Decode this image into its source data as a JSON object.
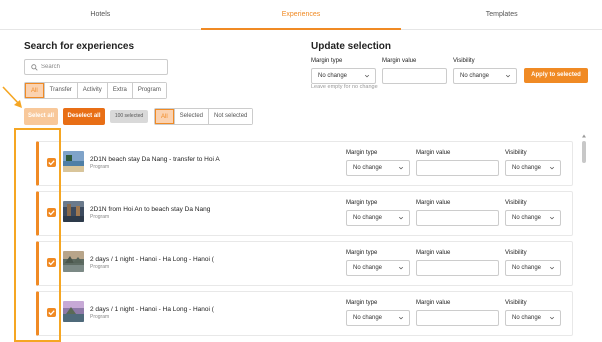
{
  "tabs": [
    "Hotels",
    "Experiences",
    "Templates"
  ],
  "search_panel": {
    "title": "Search for experiences",
    "search_placeholder": "Search",
    "type_filters": [
      "All",
      "Transfer",
      "Activity",
      "Extra",
      "Program"
    ]
  },
  "update_panel": {
    "title": "Update selection",
    "margin_type_label": "Margin type",
    "margin_value_label": "Margin value",
    "visibility_label": "Visibility",
    "margin_type_value": "No change",
    "visibility_value": "No change",
    "hint": "Leave empty for no change",
    "apply_label": "Apply to selected"
  },
  "selection_bar": {
    "select_all": "Select all",
    "deselect_all": "Deselect all",
    "count": "100 selected",
    "filters": [
      "All",
      "Selected",
      "Not selected"
    ]
  },
  "items": [
    {
      "title": "2D1N beach stay Da Nang - transfer to Hoi A",
      "type": "Program",
      "margin_type": "No change",
      "visibility": "No change",
      "checked": true
    },
    {
      "title": "2D1N from Hoi An to beach stay Da Nang",
      "type": "Program",
      "margin_type": "No change",
      "visibility": "No change",
      "checked": true
    },
    {
      "title": "2 days / 1 night - Hanoi - Ha Long - Hanoi (",
      "type": "Program",
      "margin_type": "No change",
      "visibility": "No change",
      "checked": true
    },
    {
      "title": "2 days / 1 night - Hanoi - Ha Long - Hanoi (",
      "type": "Program",
      "margin_type": "No change",
      "visibility": "No change",
      "checked": true
    }
  ],
  "item_labels": {
    "margin_type": "Margin type",
    "margin_value": "Margin value",
    "visibility": "Visibility"
  },
  "colors": {
    "accent": "#f08a24",
    "accent_light": "#fbd2b0",
    "highlight": "#f5a623"
  }
}
